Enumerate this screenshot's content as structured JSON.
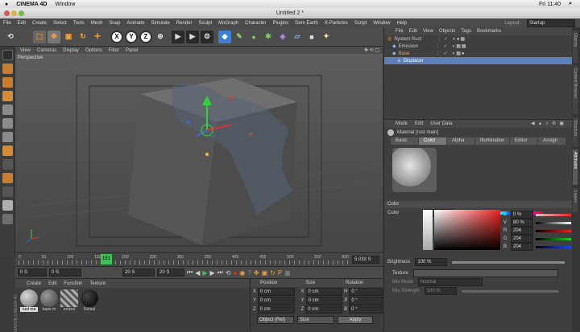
{
  "mac_menubar": {
    "apple": "",
    "app": "CINEMA 4D",
    "window": "Window",
    "clock": "Fri 11:40"
  },
  "window": {
    "title": "Untitled 2 *",
    "layout_label": "Layout:",
    "layout_value": "Startup"
  },
  "menu": [
    "File",
    "Edit",
    "Create",
    "Select",
    "Tools",
    "Mesh",
    "Snap",
    "Animate",
    "Simulate",
    "Render",
    "Sculpt",
    "MoGraph",
    "Character",
    "Plugins",
    "Dem Earth",
    "X-Particles",
    "Script",
    "Window",
    "Help"
  ],
  "toolbar": {
    "undo": "⟲",
    "axes": [
      "X",
      "Y",
      "Z"
    ]
  },
  "viewport": {
    "menu": [
      "View",
      "Cameras",
      "Display",
      "Options",
      "Filter",
      "Panel"
    ],
    "label": "Perspective"
  },
  "timeline": {
    "ticks": [
      "0",
      "50",
      "100",
      "150",
      "200",
      "250",
      "300",
      "350",
      "400",
      "450",
      "500",
      "550",
      "600"
    ],
    "current": "151",
    "end_field": "5.033 S"
  },
  "transport": {
    "start": "0 S",
    "cur": "0 S",
    "end": "20 S",
    "max": "20 S"
  },
  "material_manager": {
    "menu": [
      "Create",
      "Edit",
      "Function",
      "Texture"
    ],
    "materials": [
      "rust ma",
      "base m",
      "emissi",
      "Defaul"
    ],
    "brand": "MAXON CINEMA 4D"
  },
  "coordinates": {
    "headers": [
      "Position",
      "Size",
      "Rotation"
    ],
    "rows": [
      {
        "axis": "X",
        "pos": "0 cm",
        "size": "0 cm",
        "rot_axis": "H",
        "rot": "0 °"
      },
      {
        "axis": "Y",
        "pos": "0 cm",
        "size": "0 cm",
        "rot_axis": "P",
        "rot": "0 °"
      },
      {
        "axis": "Z",
        "pos": "0 cm",
        "size": "0 cm",
        "rot_axis": "B",
        "rot": "0 °"
      }
    ],
    "mode": "Object (Rel)",
    "size_mode": "Size",
    "apply": "Apply"
  },
  "object_manager": {
    "menu": [
      "File",
      "Edit",
      "View",
      "Objects",
      "Tags",
      "Bookmarks"
    ],
    "objects": [
      {
        "name": "System Rust",
        "indent": 0
      },
      {
        "name": "Emission",
        "indent": 1
      },
      {
        "name": "Base",
        "indent": 1
      },
      {
        "name": "Displacer",
        "indent": 2
      }
    ]
  },
  "attributes": {
    "menu": [
      "Mode",
      "Edit",
      "User Data"
    ],
    "material_title": "Material [rust main]",
    "tabs": [
      "Basic",
      "Color",
      "Alpha",
      "Illumination",
      "Editor",
      "Assign"
    ],
    "active_tab": "Color",
    "section": "Color",
    "color_label": "Color",
    "angle": "0 °",
    "hsv": [
      {
        "label": "S",
        "value": "0 %"
      },
      {
        "label": "V",
        "value": "80 %"
      },
      {
        "label": "R",
        "value": "204"
      },
      {
        "label": "G",
        "value": "204"
      },
      {
        "label": "B",
        "value": "204"
      }
    ],
    "brightness_label": "Brightness",
    "brightness_value": "100 %",
    "texture_label": "Texture",
    "mix_mode_label": "Mix Mode",
    "mix_mode_value": "Normal",
    "mix_strength_label": "Mix Strength",
    "mix_strength_value": "100 %"
  },
  "right_tabs": [
    "Objects",
    "Content Browser",
    "Structure",
    "Attributes",
    "Layers"
  ],
  "colors": {
    "accent": "#f2a23c",
    "selected": "#5b8fd6",
    "panel": "#3f3f3f"
  }
}
